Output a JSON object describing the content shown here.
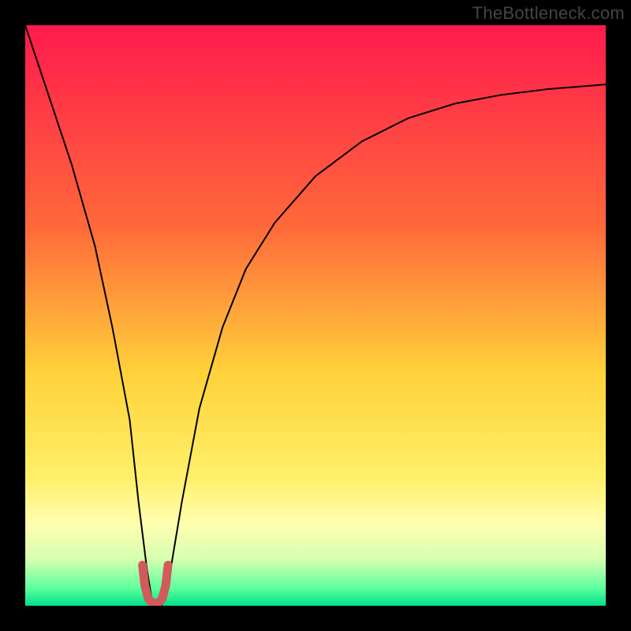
{
  "watermark": "TheBottleneck.com",
  "chart_data": {
    "type": "line",
    "title": "",
    "xlabel": "",
    "ylabel": "",
    "xlim": [
      0,
      100
    ],
    "ylim": [
      0,
      100
    ],
    "background_gradient": {
      "stops": [
        {
          "offset": 0.0,
          "color": "#ff1a4d"
        },
        {
          "offset": 0.35,
          "color": "#ff6a3a"
        },
        {
          "offset": 0.6,
          "color": "#ffd23a"
        },
        {
          "offset": 0.78,
          "color": "#fff06a"
        },
        {
          "offset": 0.86,
          "color": "#ffffb0"
        },
        {
          "offset": 0.92,
          "color": "#d6ffb0"
        },
        {
          "offset": 0.97,
          "color": "#5cff9e"
        },
        {
          "offset": 1.0,
          "color": "#00e08a"
        }
      ]
    },
    "series": [
      {
        "name": "bottleneck-curve",
        "color": "#000000",
        "stroke_width": 2,
        "x": [
          0,
          4,
          8,
          12,
          15,
          18,
          19.5,
          21,
          22,
          23.5,
          25,
          27,
          30,
          34,
          38,
          43,
          50,
          58,
          66,
          74,
          82,
          90,
          100
        ],
        "values": [
          100,
          88,
          76,
          62,
          48,
          32,
          18,
          6,
          0,
          0,
          6,
          18,
          34,
          48,
          58,
          66,
          74,
          80,
          84,
          86.5,
          88,
          89,
          89.8
        ]
      }
    ],
    "marker": {
      "name": "optimal-range-marker",
      "color": "#d25a5a",
      "stroke_width": 11,
      "x": [
        20.2,
        20.6,
        21.2,
        22.0,
        22.8,
        23.6,
        24.2,
        24.6
      ],
      "values": [
        7.0,
        3.5,
        1.2,
        0.4,
        0.4,
        1.2,
        3.5,
        7.0
      ]
    }
  }
}
